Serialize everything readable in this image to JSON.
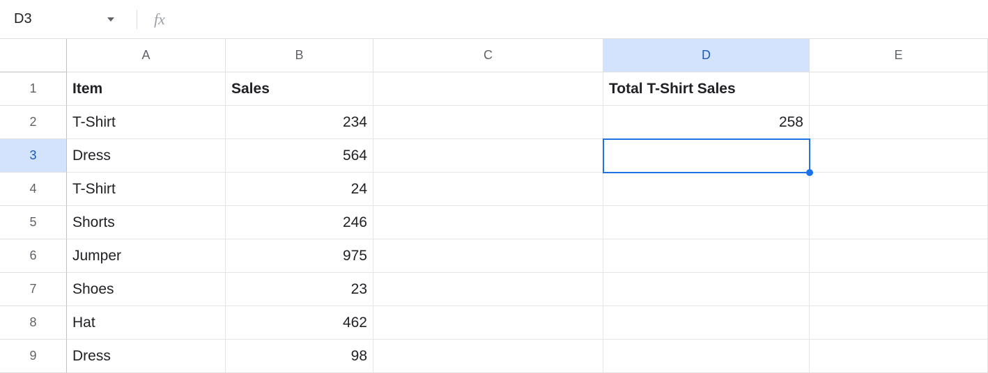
{
  "nameBox": {
    "value": "D3"
  },
  "formulaBar": {
    "value": "",
    "placeholder": ""
  },
  "columns": [
    "A",
    "B",
    "C",
    "D",
    "E"
  ],
  "rows": [
    "1",
    "2",
    "3",
    "4",
    "5",
    "6",
    "7",
    "8",
    "9"
  ],
  "selectedColumn": "D",
  "selectedRow": "3",
  "data": {
    "A": {
      "1": "Item",
      "2": "T-Shirt",
      "3": "Dress",
      "4": "T-Shirt",
      "5": "Shorts",
      "6": "Jumper",
      "7": "Shoes",
      "8": "Hat",
      "9": "Dress"
    },
    "B": {
      "1": "Sales",
      "2": "234",
      "3": "564",
      "4": "24",
      "5": "246",
      "6": "975",
      "7": "23",
      "8": "462",
      "9": "98"
    },
    "C": {},
    "D": {
      "1": "Total T-Shirt Sales",
      "2": "258"
    },
    "E": {}
  },
  "selection": {
    "cell": "D3"
  }
}
